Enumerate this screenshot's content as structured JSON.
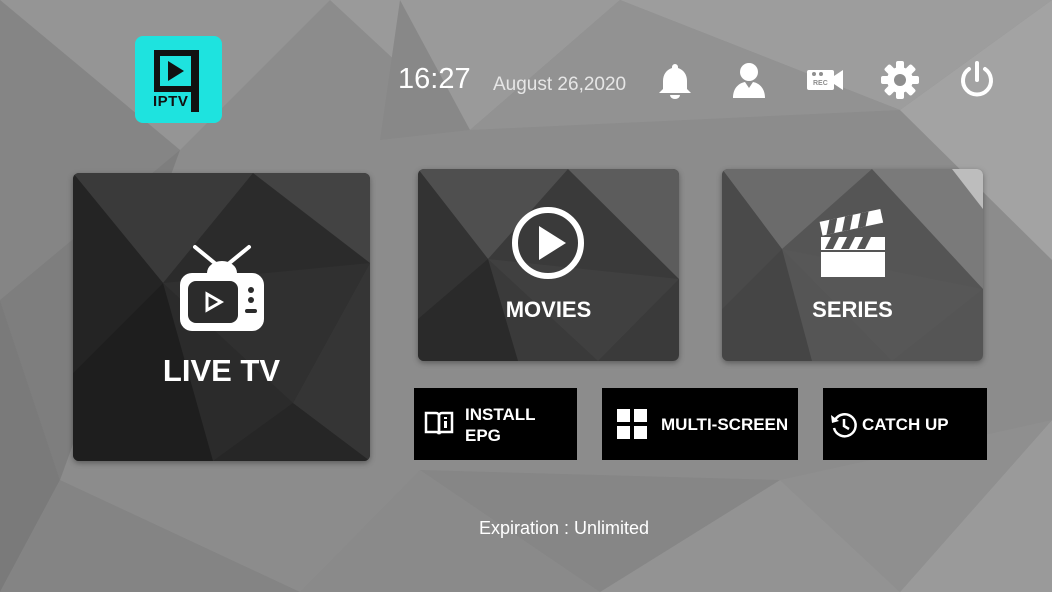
{
  "logo": {
    "text": "IPTV"
  },
  "header": {
    "time": "16:27",
    "date": "August 26,2020",
    "icons": [
      "bell-icon",
      "user-icon",
      "record-icon",
      "gear-icon",
      "power-icon"
    ],
    "record_badge": "REC"
  },
  "tiles": {
    "live_tv": "LIVE TV",
    "movies": "MOVIES",
    "series": "SERIES"
  },
  "buttons": {
    "install_epg_line1": "INSTALL",
    "install_epg_line2": "EPG",
    "multi_screen": "MULTI-SCREEN",
    "catch_up": "CATCH UP"
  },
  "footer": {
    "expiration": "Expiration : Unlimited"
  },
  "colors": {
    "accent": "#1ee3df",
    "background": "#8e8e8e",
    "button_bg": "#000000"
  }
}
